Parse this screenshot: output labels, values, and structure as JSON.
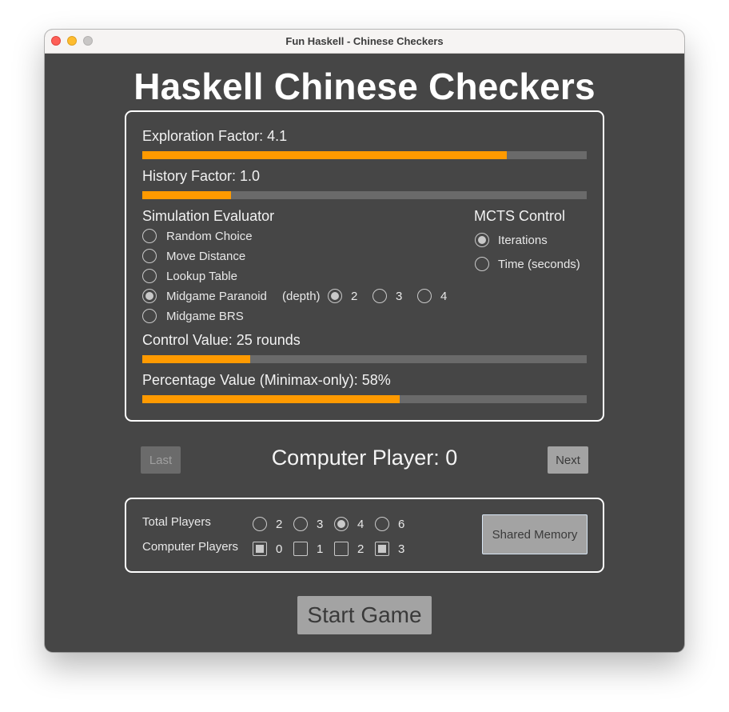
{
  "window": {
    "title": "Fun Haskell - Chinese Checkers"
  },
  "app_title": "Haskell Chinese Checkers",
  "settings": {
    "exploration": {
      "label": "Exploration Factor: 4.1",
      "fraction": 0.82
    },
    "history": {
      "label": "History Factor: 1.0",
      "fraction": 0.2
    },
    "evaluator": {
      "heading": "Simulation Evaluator",
      "options": [
        "Random Choice",
        "Move Distance",
        "Lookup Table",
        "Midgame Paranoid",
        "Midgame BRS"
      ],
      "selected": "Midgame Paranoid",
      "depth_label": "(depth)",
      "depth_options": [
        "2",
        "3",
        "4"
      ],
      "depth_selected": "2"
    },
    "mcts": {
      "heading": "MCTS Control",
      "options": [
        "Iterations",
        "Time (seconds)"
      ],
      "selected": "Iterations"
    },
    "control_value": {
      "label": "Control Value: 25 rounds",
      "fraction": 0.243
    },
    "percentage_value": {
      "label": "Percentage Value (Minimax-only): 58%",
      "fraction": 0.58
    }
  },
  "navigation": {
    "last_label": "Last",
    "next_label": "Next",
    "player_label": "Computer Player: 0"
  },
  "players": {
    "total_label": "Total Players",
    "total_options": [
      "2",
      "3",
      "4",
      "6"
    ],
    "total_selected": "4",
    "computer_label": "Computer Players",
    "computer_options": [
      "0",
      "1",
      "2",
      "3"
    ],
    "computer_checked": [
      "0",
      "3"
    ],
    "shared_memory_label": "Shared Memory"
  },
  "start_label": "Start Game",
  "colors": {
    "accent": "#ff9a00",
    "background": "#464646",
    "track": "#6a6a6a",
    "button": "#a3a3a3"
  }
}
